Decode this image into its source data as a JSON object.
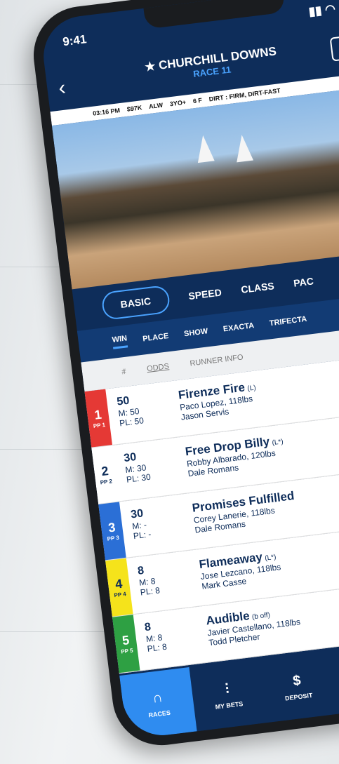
{
  "status": {
    "time": "9:41"
  },
  "header": {
    "title": "★ CHURCHILL DOWNS",
    "race": "RACE 11"
  },
  "info": [
    "03:16 PM",
    "$97K",
    "ALW",
    "3YO+",
    "6 F",
    "DIRT : FIRM, DIRT-FAST"
  ],
  "tabs": [
    "BASIC",
    "SPEED",
    "CLASS",
    "PAC"
  ],
  "bet_types": [
    "WIN",
    "PLACE",
    "SHOW",
    "EXACTA",
    "TRIFECTA"
  ],
  "columns": {
    "num": "#",
    "odds": "ODDS",
    "runner": "RUNNER INFO"
  },
  "runners": [
    {
      "pp": "1",
      "pp_label": "PP 1",
      "color": "#e53935",
      "text": "#ffffff",
      "odds": "50",
      "m": "M: 50",
      "pl": "PL: 50",
      "name": "Firenze Fire",
      "med": "(L)",
      "jockey": "Paco Lopez, 118lbs",
      "trainer": "Jason Servis"
    },
    {
      "pp": "2",
      "pp_label": "PP 2",
      "color": "#ffffff",
      "text": "#0e2d5a",
      "odds": "30",
      "m": "M: 30",
      "pl": "PL: 30",
      "name": "Free Drop Billy",
      "med": "(L*)",
      "jockey": "Robby Albarado, 120lbs",
      "trainer": "Dale Romans"
    },
    {
      "pp": "3",
      "pp_label": "PP 3",
      "color": "#2b6fd6",
      "text": "#ffffff",
      "odds": "30",
      "m": "M: -",
      "pl": "PL: -",
      "name": "Promises Fulfilled",
      "med": "",
      "jockey": "Corey Lanerie, 118lbs",
      "trainer": "Dale Romans"
    },
    {
      "pp": "4",
      "pp_label": "PP 4",
      "color": "#f5e31b",
      "text": "#0e2d5a",
      "odds": "8",
      "m": "M: 8",
      "pl": "PL: 8",
      "name": "Flameaway",
      "med": "(L*)",
      "jockey": "Jose Lezcano, 118lbs",
      "trainer": "Mark Casse"
    },
    {
      "pp": "5",
      "pp_label": "PP 5",
      "color": "#2ea043",
      "text": "#ffffff",
      "odds": "8",
      "m": "M: 8",
      "pl": "PL: 8",
      "name": "Audible",
      "med": "(b off)",
      "jockey": "Javier Castellano, 118lbs",
      "trainer": "Todd Pletcher"
    }
  ],
  "nav": [
    {
      "label": "RACES",
      "icon": "horseshoe-icon"
    },
    {
      "label": "MY BETS",
      "icon": "tickets-icon"
    },
    {
      "label": "DEPOSIT",
      "icon": "dollar-icon"
    }
  ]
}
